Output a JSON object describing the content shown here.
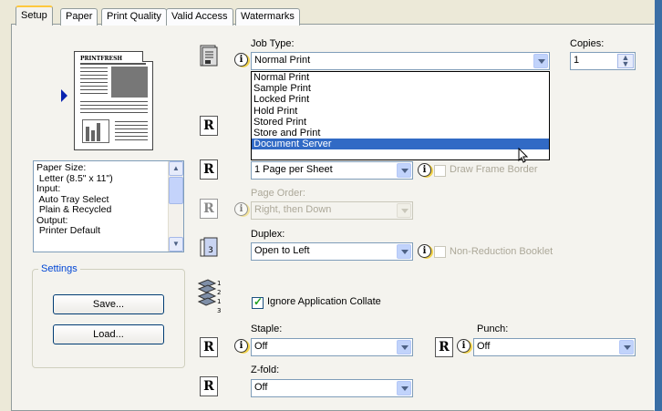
{
  "tabs": [
    {
      "label": "Setup",
      "active": true
    },
    {
      "label": "Paper",
      "active": false
    },
    {
      "label": "Print Quality",
      "active": false
    },
    {
      "label": "Valid Access",
      "active": false
    },
    {
      "label": "Watermarks",
      "active": false
    }
  ],
  "preview": {
    "masthead": "PRINTFRESH"
  },
  "info_list": [
    "Paper Size:",
    " Letter (8.5\" x 11\")",
    "Input:",
    " Auto Tray Select",
    " Plain & Recycled",
    "Output:",
    " Printer Default"
  ],
  "settings": {
    "group_label": "Settings",
    "save_label": "Save...",
    "load_label": "Load..."
  },
  "job_type": {
    "label": "Job Type:",
    "value": "Normal Print",
    "options": [
      "Normal Print",
      "Sample Print",
      "Locked Print",
      "Hold Print",
      "Stored Print",
      "Store and Print",
      "Document Server"
    ],
    "highlighted": "Document Server"
  },
  "copies": {
    "label": "Copies:",
    "value": "1"
  },
  "pages_per_sheet": {
    "value": "1 Page per Sheet",
    "draw_frame_border": "Draw Frame Border"
  },
  "page_order": {
    "label": "Page Order:",
    "value": "Right, then Down"
  },
  "duplex": {
    "label": "Duplex:",
    "value": "Open to Left",
    "non_reduction_booklet": "Non-Reduction Booklet"
  },
  "collate": {
    "label": "Ignore Application Collate",
    "checked": true
  },
  "staple": {
    "label": "Staple:",
    "value": "Off"
  },
  "punch": {
    "label": "Punch:",
    "value": "Off"
  },
  "zfold": {
    "label": "Z-fold:",
    "value": "Off"
  },
  "icons": {
    "r_letter": "R",
    "info_letter": "i"
  },
  "colors": {
    "accent": "#316ac5",
    "tab_highlight": "#ffc83c",
    "group_label": "#0046d5",
    "window_bg": "#ece9d8"
  }
}
